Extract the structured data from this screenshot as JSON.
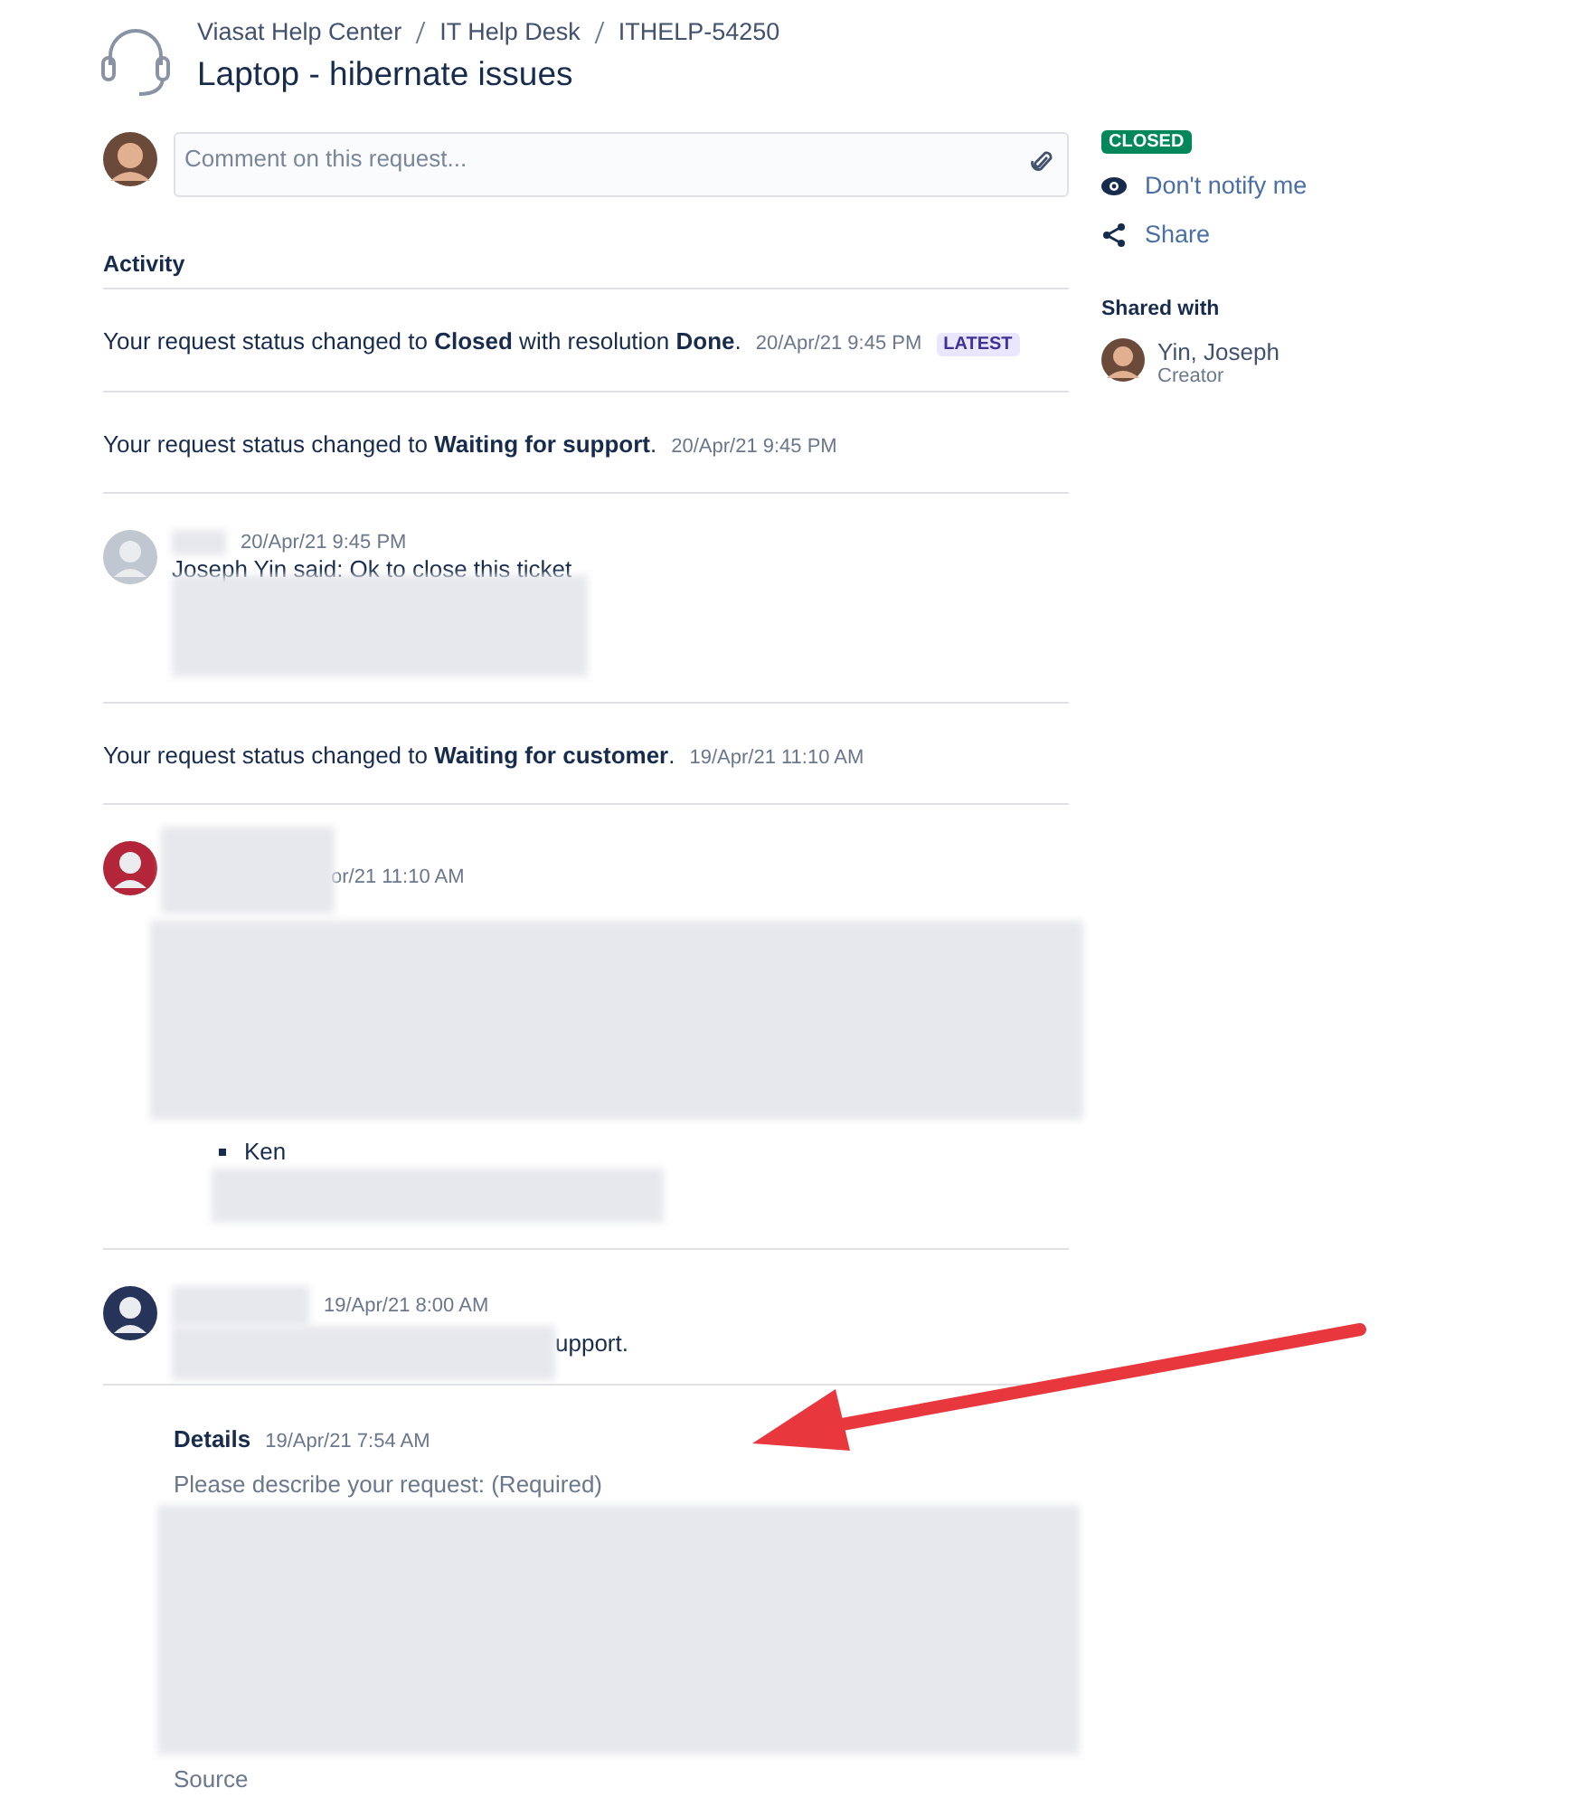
{
  "breadcrumbs": [
    "Viasat Help Center",
    "IT Help Desk",
    "ITHELP-54250"
  ],
  "title": "Laptop - hibernate issues",
  "comment_field": {
    "placeholder": "Comment on this request..."
  },
  "activity": {
    "heading": "Activity",
    "items": [
      {
        "kind": "status",
        "text": "Your request status changed to **Closed** with resolution **Done**.",
        "time": "20/Apr/21 9:45 PM",
        "badge": "LATEST"
      },
      {
        "kind": "status",
        "text": "Your request status changed to **Waiting for support**.",
        "time": "20/Apr/21 9:45 PM"
      },
      {
        "kind": "comment",
        "avatar": {
          "kind": "default"
        },
        "time": "20/Apr/21 9:45 PM",
        "blocks": [
          {
            "kind": "text",
            "text": "Joseph Yin said: Ok to close this ticket"
          },
          {
            "kind": "redacted_block"
          }
        ]
      },
      {
        "kind": "status",
        "text": "Your request status changed to **Waiting for customer**.",
        "time": "19/Apr/21 11:10 AM"
      },
      {
        "kind": "comment",
        "avatar": {
          "kind": "photo"
        },
        "time": "or/21 11:10 AM",
        "blocks": [
          {
            "kind": "redacted_large"
          },
          {
            "kind": "bullet",
            "text": "Ken"
          },
          {
            "kind": "redacted_line"
          }
        ]
      },
      {
        "kind": "comment",
        "avatar": {
          "kind": "emblem"
        },
        "time": "19/Apr/21 8:00 AM",
        "blocks": [
          {
            "kind": "redacted_then_text",
            "text": "upport."
          }
        ]
      },
      {
        "kind": "details",
        "title": "Details",
        "time": "19/Apr/21 7:54 AM",
        "label": "Please describe your request: (Required)",
        "after": "Source"
      }
    ]
  },
  "sidebar": {
    "status": "CLOSED",
    "actions": [
      {
        "kind": "eye",
        "label": "Don't notify me"
      },
      {
        "kind": "share",
        "label": "Share"
      }
    ],
    "shared_heading": "Shared with",
    "people": [
      {
        "name": "Yin, Joseph",
        "role": "Creator"
      }
    ]
  }
}
